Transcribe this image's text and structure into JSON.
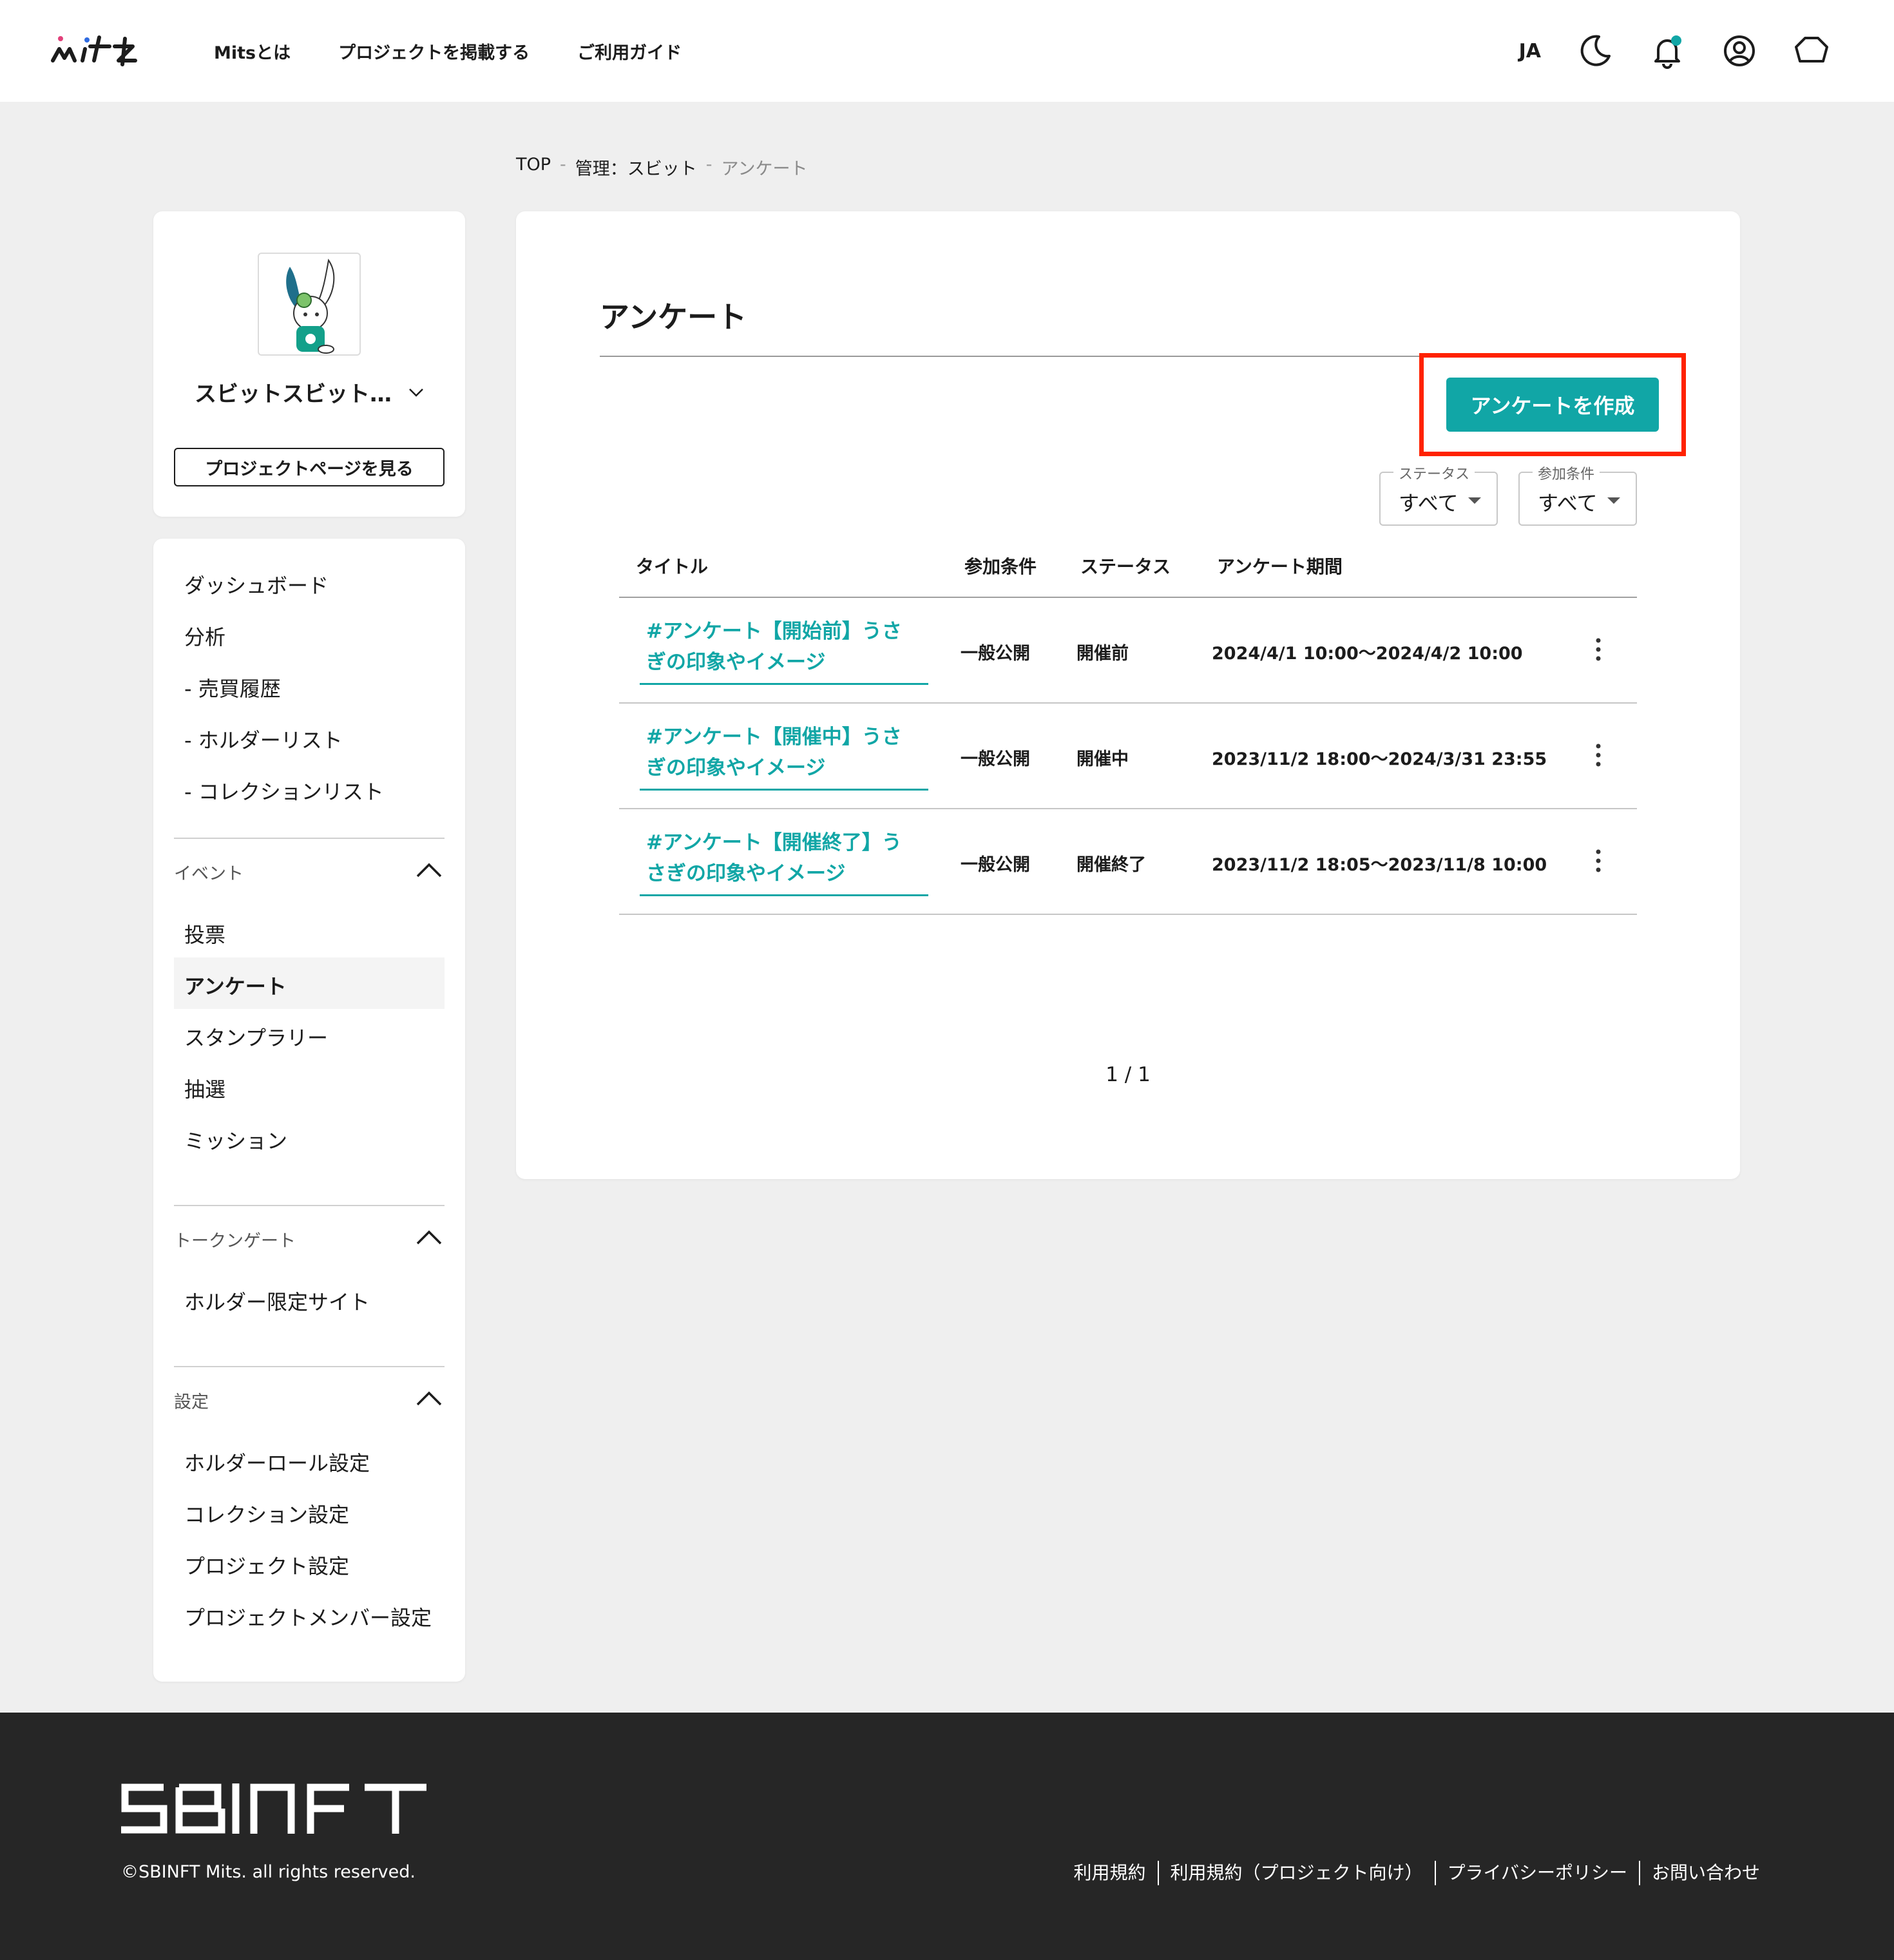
{
  "header": {
    "logo_text": "mits",
    "nav": [
      "Mitsとは",
      "プロジェクトを掲載する",
      "ご利用ガイド"
    ],
    "lang": "JA",
    "icons": [
      "moon-icon",
      "bell-icon",
      "user-icon",
      "wallet-icon"
    ],
    "accent": "#11a6a6"
  },
  "breadcrumb": {
    "items": [
      "TOP",
      "管理：スビット",
      "アンケート"
    ],
    "sep": "-"
  },
  "project": {
    "name": "スビットスビット…",
    "view_button": "プロジェクトページを見る"
  },
  "menu": {
    "top_items": [
      "ダッシュボード",
      "分析",
      "- 売買履歴",
      "- ホルダーリスト",
      "- コレクションリスト"
    ],
    "sections": [
      {
        "title": "イベント",
        "items": [
          "投票",
          "アンケート",
          "スタンプラリー",
          "抽選",
          "ミッション"
        ]
      },
      {
        "title": "トークンゲート",
        "items": [
          "ホルダー限定サイト"
        ]
      },
      {
        "title": "設定",
        "items": [
          "ホルダーロール設定",
          "コレクション設定",
          "プロジェクト設定",
          "プロジェクトメンバー設定"
        ]
      }
    ],
    "active": "アンケート"
  },
  "main": {
    "title": "アンケート",
    "create_button": "アンケートを作成",
    "filters": [
      {
        "label": "ステータス",
        "value": "すべて"
      },
      {
        "label": "参加条件",
        "value": "すべて"
      }
    ],
    "columns": [
      "タイトル",
      "参加条件",
      "ステータス",
      "アンケート期間"
    ],
    "rows": [
      {
        "title_line1": "#アンケート【開始前】うさ",
        "title_line2": "ぎの印象やイメージ",
        "condition": "一般公開",
        "status": "開催前",
        "period": "2024/4/1 10:00〜2024/4/2 10:00"
      },
      {
        "title_line1": "#アンケート【開催中】うさ",
        "title_line2": "ぎの印象やイメージ",
        "condition": "一般公開",
        "status": "開催中",
        "period": "2023/11/2 18:00〜2024/3/31 23:55"
      },
      {
        "title_line1": "#アンケート【開催終了】う",
        "title_line2": "さぎの印象やイメージ",
        "condition": "一般公開",
        "status": "開催終了",
        "period": "2023/11/2 18:05〜2023/11/8 10:00"
      }
    ],
    "pager": "1 / 1"
  },
  "footer": {
    "logo_text": "SBINFT",
    "copyright": "©SBINFT Mits. all rights reserved.",
    "links": [
      "利用規約",
      "利用規約（プロジェクト向け）",
      "プライバシーポリシー",
      "お問い合わせ"
    ]
  }
}
